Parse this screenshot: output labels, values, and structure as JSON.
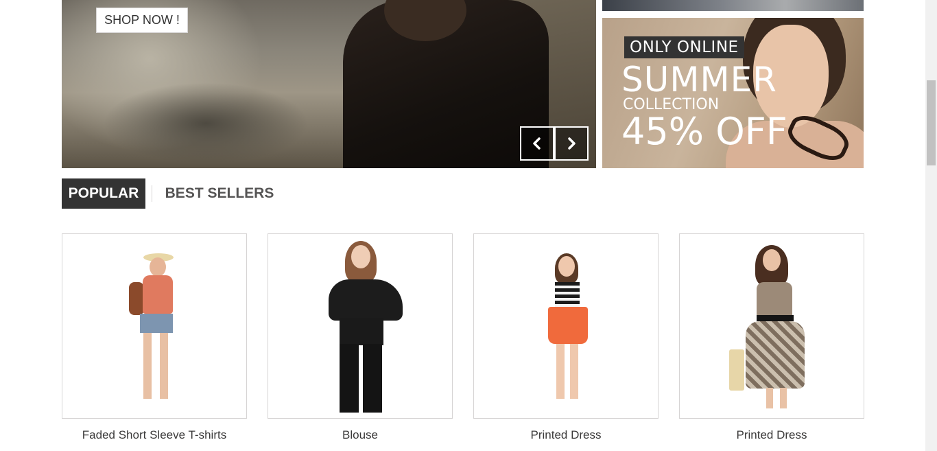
{
  "hero": {
    "cta_label": "SHOP NOW !",
    "prev_icon": "chevron-left-icon",
    "next_icon": "chevron-right-icon"
  },
  "promo": {
    "badge": "ONLY ONLINE",
    "title": "SUMMER",
    "subtitle": "COLLECTION",
    "discount": "45% OFF"
  },
  "tabs": [
    {
      "label": "POPULAR",
      "active": true
    },
    {
      "label": "BEST SELLERS",
      "active": false
    }
  ],
  "products": [
    {
      "name": "Faded Short Sleeve T-shirts"
    },
    {
      "name": "Blouse"
    },
    {
      "name": "Printed Dress"
    },
    {
      "name": "Printed Dress"
    }
  ],
  "colors": {
    "dark": "#333333",
    "border": "#d6d4d4",
    "tab_inactive": "#555454",
    "product_text": "#3a3939"
  }
}
